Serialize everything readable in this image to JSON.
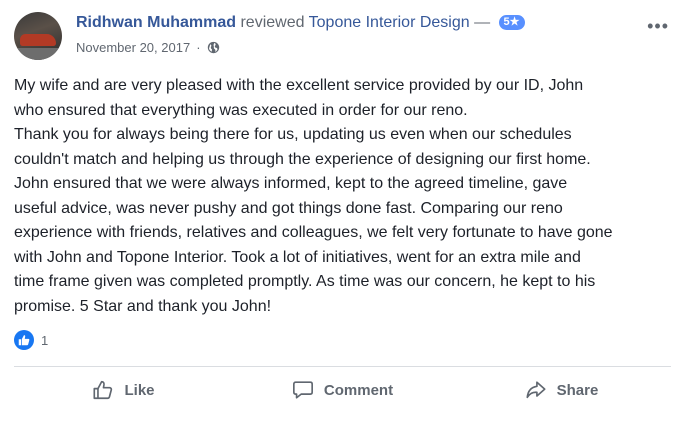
{
  "header": {
    "author": "Ridhwan Muhammad",
    "verb": "reviewed",
    "page": "Topone Interior Design",
    "dash": "—",
    "rating": "5★",
    "date": "November 20, 2017",
    "separator": "·",
    "privacy_icon": "globe-icon",
    "more_icon": "more-options-icon",
    "more_label": "•••"
  },
  "review": {
    "lines": [
      "My wife and are very pleased with the excellent service provided by our ID, John",
      "who ensured that everything was executed in order for our reno.",
      "Thank you for always being there for us, updating us even when our schedules",
      "couldn't match and helping us through the experience of designing our first home.",
      "John ensured that we were always informed, kept to the agreed timeline, gave",
      "useful advice, was never pushy and got things done fast. Comparing our reno",
      "experience with friends, relatives and colleagues, we felt very fortunate to have gone",
      "with John and Topone Interior. Took a lot of initiatives, went for an extra mile and",
      "time frame given was completed promptly. As time was our concern, he kept to his",
      "promise. 5 Star and thank you John!"
    ]
  },
  "reactions": {
    "icon": "like-reaction-icon",
    "count": "1"
  },
  "actions": [
    {
      "label": "Like",
      "icon": "thumbs-up-icon"
    },
    {
      "label": "Comment",
      "icon": "comment-icon"
    },
    {
      "label": "Share",
      "icon": "share-icon"
    }
  ],
  "colors": {
    "link": "#365899",
    "badge": "#5890ff",
    "like": "#1877f2",
    "muted": "#606770"
  }
}
